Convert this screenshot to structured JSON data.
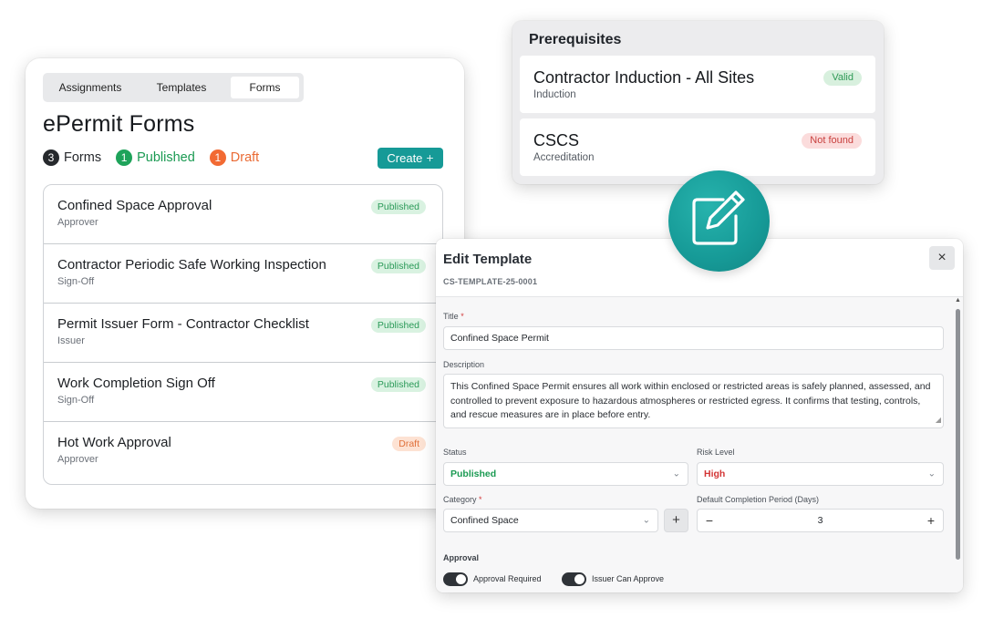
{
  "forms": {
    "tabs": [
      "Assignments",
      "Templates",
      "Forms"
    ],
    "title": "ePermit Forms",
    "counts": {
      "total": "3",
      "total_label": "Forms",
      "published": "1",
      "published_label": "Published",
      "draft": "1",
      "draft_label": "Draft"
    },
    "create_label": "Create",
    "items": [
      {
        "title": "Confined Space Approval",
        "sub": "Approver",
        "status": "Published"
      },
      {
        "title": "Contractor Periodic Safe Working Inspection",
        "sub": "Sign-Off",
        "status": "Published"
      },
      {
        "title": "Permit Issuer Form - Contractor Checklist",
        "sub": "Issuer",
        "status": "Published"
      },
      {
        "title": "Work Completion Sign Off",
        "sub": "Sign-Off",
        "status": "Published"
      },
      {
        "title": "Hot Work Approval",
        "sub": "Approver",
        "status": "Draft"
      }
    ]
  },
  "prereq": {
    "title": "Prerequisites",
    "items": [
      {
        "title": "Contractor Induction - All Sites",
        "sub": "Induction",
        "status": "Valid"
      },
      {
        "title": "CSCS",
        "sub": "Accreditation",
        "status": "Not found"
      }
    ]
  },
  "edit": {
    "title": "Edit Template",
    "code": "CS-TEMPLATE-25-0001",
    "close": "×",
    "title_label": "Title",
    "required_mark": "*",
    "title_value": "Confined Space Permit",
    "description_label": "Description",
    "description_value": "This Confined Space Permit ensures all work within enclosed or restricted areas is safely planned, assessed, and controlled to prevent exposure to hazardous atmospheres or restricted egress. It confirms that testing, controls, and rescue measures are in place before entry.",
    "status_label": "Status",
    "status_value": "Published",
    "risk_label": "Risk Level",
    "risk_value": "High",
    "category_label": "Category",
    "category_value": "Confined Space",
    "period_label": "Default Completion Period (Days)",
    "period_value": "3",
    "approval_label": "Approval",
    "toggles": [
      "Approval Required",
      "Issuer Can Approve"
    ]
  },
  "colors": {
    "accent": "#169a97",
    "published_green": "#1a9a52",
    "draft_orange": "#ea6a33",
    "high_red": "#d33535"
  },
  "icons": [
    "plus-icon",
    "pencil-icon",
    "close-icon",
    "chevron-down-icon",
    "minus-icon"
  ]
}
